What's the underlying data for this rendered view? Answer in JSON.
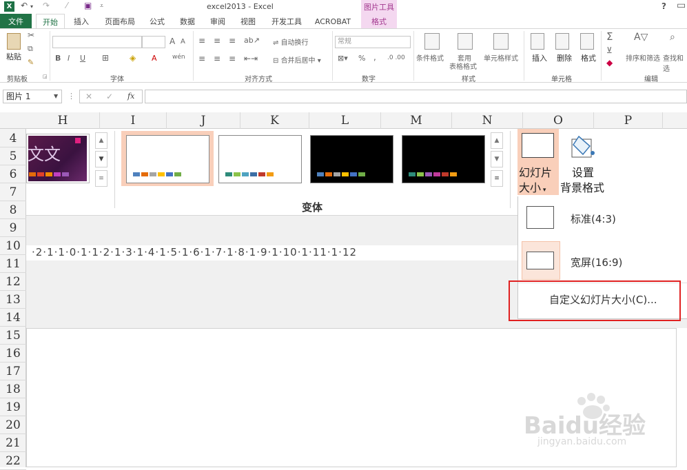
{
  "titlebar": {
    "app_icon": "X",
    "window_title": "excel2013 - Excel",
    "context_group": "图片工具",
    "help": "?"
  },
  "tabs": {
    "file": "文件",
    "home": "开始",
    "insert": "插入",
    "page_layout": "页面布局",
    "formulas": "公式",
    "data": "数据",
    "review": "审阅",
    "view": "视图",
    "developer": "开发工具",
    "acrobat": "ACROBAT",
    "format": "格式"
  },
  "ribbon": {
    "clipboard": {
      "paste": "粘贴",
      "label": "剪贴板"
    },
    "font": {
      "label": "字体",
      "bold": "B",
      "italic": "I",
      "underline": "U",
      "grow": "A",
      "shrink": "A",
      "font_color": "A",
      "wen": "wén"
    },
    "alignment": {
      "label": "对齐方式",
      "wrap": "自动换行",
      "merge": "合并后居中"
    },
    "number": {
      "label": "数字",
      "format": "常规",
      "percent": "%",
      "comma": ","
    },
    "styles": {
      "label": "样式",
      "conditional": "条件格式",
      "table_line1": "套用",
      "table_line2": "表格格式",
      "cell_styles": "单元格样式"
    },
    "cells": {
      "label": "单元格",
      "insert": "插入",
      "delete": "删除",
      "format": "格式"
    },
    "editing": {
      "label": "编辑",
      "sigma": "Σ",
      "sort": "排序和筛选",
      "find": "查找和选"
    }
  },
  "formula_bar": {
    "name_box": "图片 1",
    "cancel": "✕",
    "enter": "✓",
    "fx": "fx",
    "formula": ""
  },
  "sheet": {
    "columns": [
      "H",
      "I",
      "J",
      "K",
      "L",
      "M",
      "N",
      "O",
      "P"
    ],
    "rows": [
      "4",
      "5",
      "6",
      "7",
      "8",
      "9",
      "10",
      "11",
      "12",
      "13",
      "14",
      "15",
      "16",
      "17",
      "18",
      "19",
      "20",
      "21",
      "22"
    ]
  },
  "ppt": {
    "variants_label": "变体",
    "thumb_text": "文文",
    "ruler_text": "·2·1·1·0·1·1·2·1·3·1·4·1·5·1·6·1·7·1·8·1·9·1·10·1·11·1·12",
    "slide_size_line1": "幻灯片",
    "slide_size_line2": "大小",
    "bg_format_line1": "设置",
    "bg_format_line2": "背景格式",
    "colors": {
      "blue": "#4f81bd",
      "orange": "#e46c0a",
      "grey": "#a5a5a5",
      "yellow": "#ffc000",
      "steel": "#4472c4",
      "green": "#70ad47",
      "teal": "#2e8b7a",
      "lime": "#8bc34a",
      "red": "#c0392b",
      "purple": "#9b59b6",
      "magenta": "#c0399b"
    }
  },
  "dropdown": {
    "standard": "标准(4:3)",
    "widescreen": "宽屏(16:9)",
    "custom": "自定义幻灯片大小(C)..."
  },
  "watermark": {
    "brand": "Baidu经验",
    "url": "jingyan.baidu.com"
  }
}
